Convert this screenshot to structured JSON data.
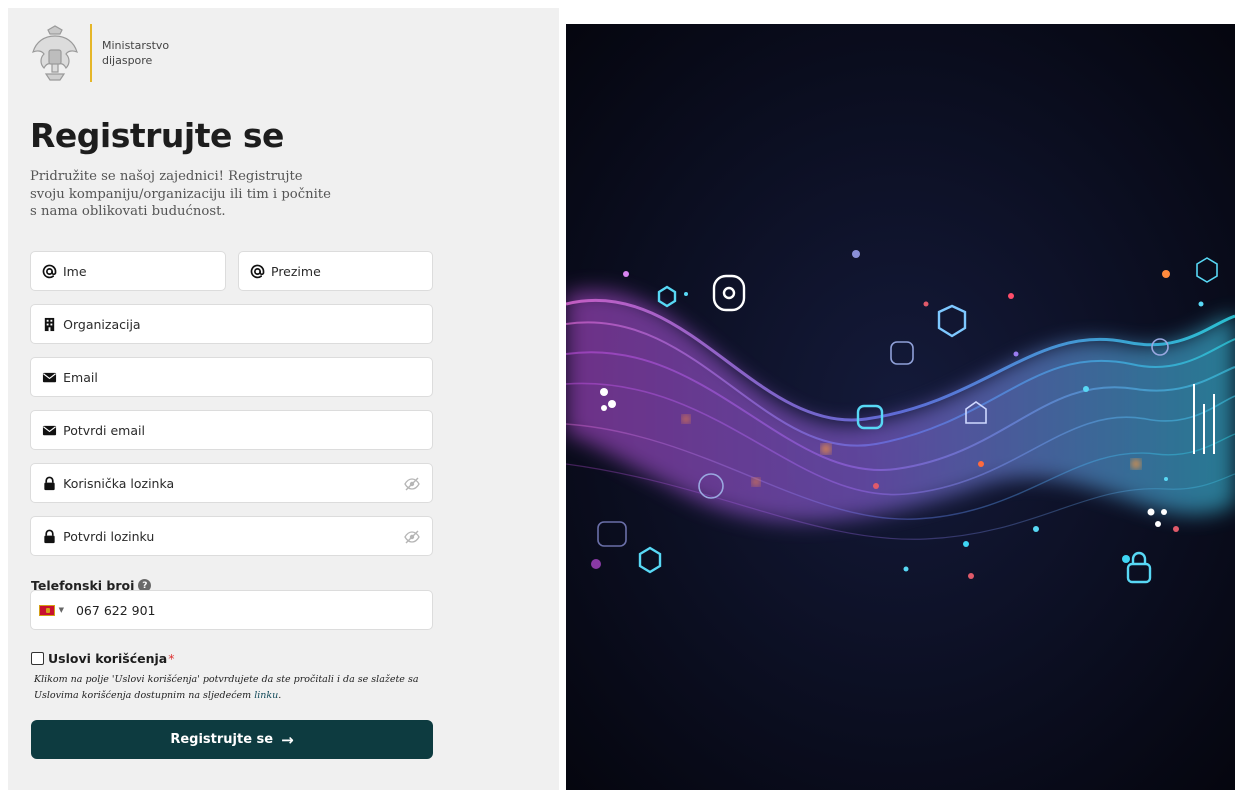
{
  "brand": {
    "ministry_line1": "Ministarstvo",
    "ministry_line2": "dijaspore"
  },
  "heading": "Registrujte se",
  "subtitle": "Pridružite se našoj zajednici! Registrujte svoju kompaniju/organizaciju ili tim i počnite s nama oblikovati budućnost.",
  "fields": {
    "first_name": {
      "placeholder": "Ime",
      "icon": "at-icon"
    },
    "last_name": {
      "placeholder": "Prezime",
      "icon": "at-icon"
    },
    "organization": {
      "placeholder": "Organizacija",
      "icon": "building-icon"
    },
    "email": {
      "placeholder": "Email",
      "icon": "envelope-icon"
    },
    "confirm_email": {
      "placeholder": "Potvrdi email",
      "icon": "envelope-icon"
    },
    "password": {
      "placeholder": "Korisnička lozinka",
      "icon": "lock-icon"
    },
    "confirm_password": {
      "placeholder": "Potvrdi lozinku",
      "icon": "lock-icon"
    }
  },
  "phone": {
    "label": "Telefonski broj",
    "value": "067 622 901",
    "country": "ME"
  },
  "terms": {
    "label": "Uslovi korišćenja",
    "required_mark": "*",
    "note_text": "Klikom na polje 'Uslovi korišćenja' potvrdujete da ste pročitali i da se slažete sa Uslovima korišćenja dostupnim na sljedećem ",
    "link_text": "linku",
    "note_end": "."
  },
  "submit": {
    "label": "Registrujte se",
    "arrow": "→"
  },
  "colors": {
    "panel_bg": "#f0f0f0",
    "accent_gold": "#e5b628",
    "button_bg": "#0d3b40",
    "hero_bg": "#07091a"
  }
}
